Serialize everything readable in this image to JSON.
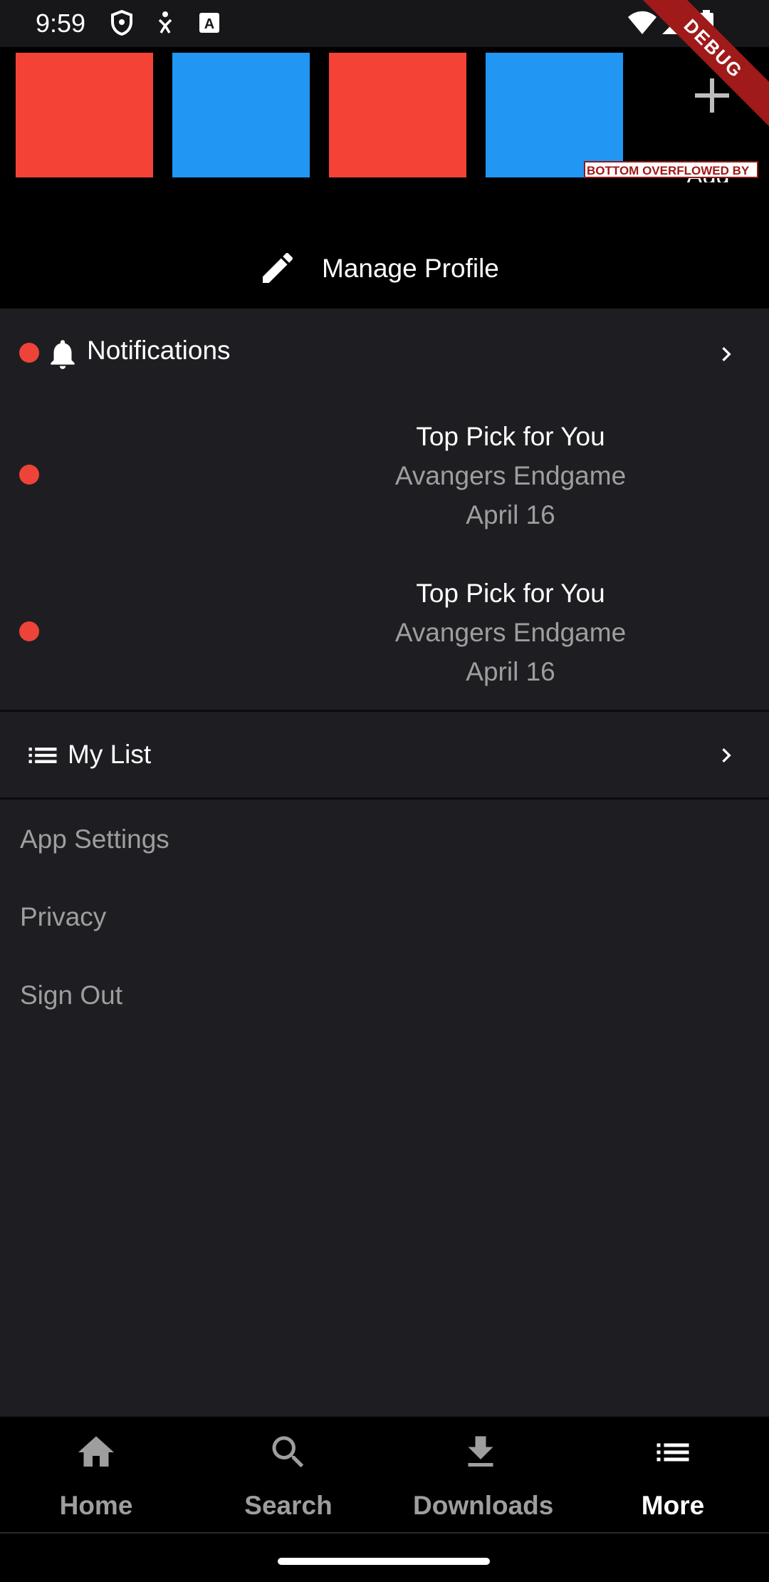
{
  "status_bar": {
    "time": "9:59"
  },
  "debug_banner": "DEBUG",
  "profiles": {
    "tiles": [
      {
        "color": "#f44336"
      },
      {
        "color": "#2196f3"
      },
      {
        "color": "#f44336"
      },
      {
        "color": "#2196f3"
      }
    ],
    "add_label": "Add",
    "overflow_warning": "BOTTOM OVERFLOWED BY",
    "manage_label": "Manage Profile"
  },
  "notifications": {
    "title": "Notifications",
    "items": [
      {
        "title": "Top Pick for You",
        "subtitle": "Avangers Endgame",
        "date": "April 16"
      },
      {
        "title": "Top Pick for You",
        "subtitle": "Avangers Endgame",
        "date": "April 16"
      }
    ]
  },
  "my_list": {
    "label": "My List"
  },
  "menu": {
    "app_settings": "App Settings",
    "privacy": "Privacy",
    "sign_out": "Sign Out"
  },
  "bottom_nav": {
    "items": [
      {
        "label": "Home",
        "icon": "home-icon",
        "active": false
      },
      {
        "label": "Search",
        "icon": "search-icon",
        "active": false
      },
      {
        "label": "Downloads",
        "icon": "download-icon",
        "active": false
      },
      {
        "label": "More",
        "icon": "list-icon",
        "active": true
      }
    ],
    "active_color": "#ffffff",
    "inactive_color": "#9e9e9e"
  },
  "colors": {
    "background": "#1e1e22",
    "accent_dot": "#ee4338",
    "debug_ribbon": "#a01a1a"
  }
}
